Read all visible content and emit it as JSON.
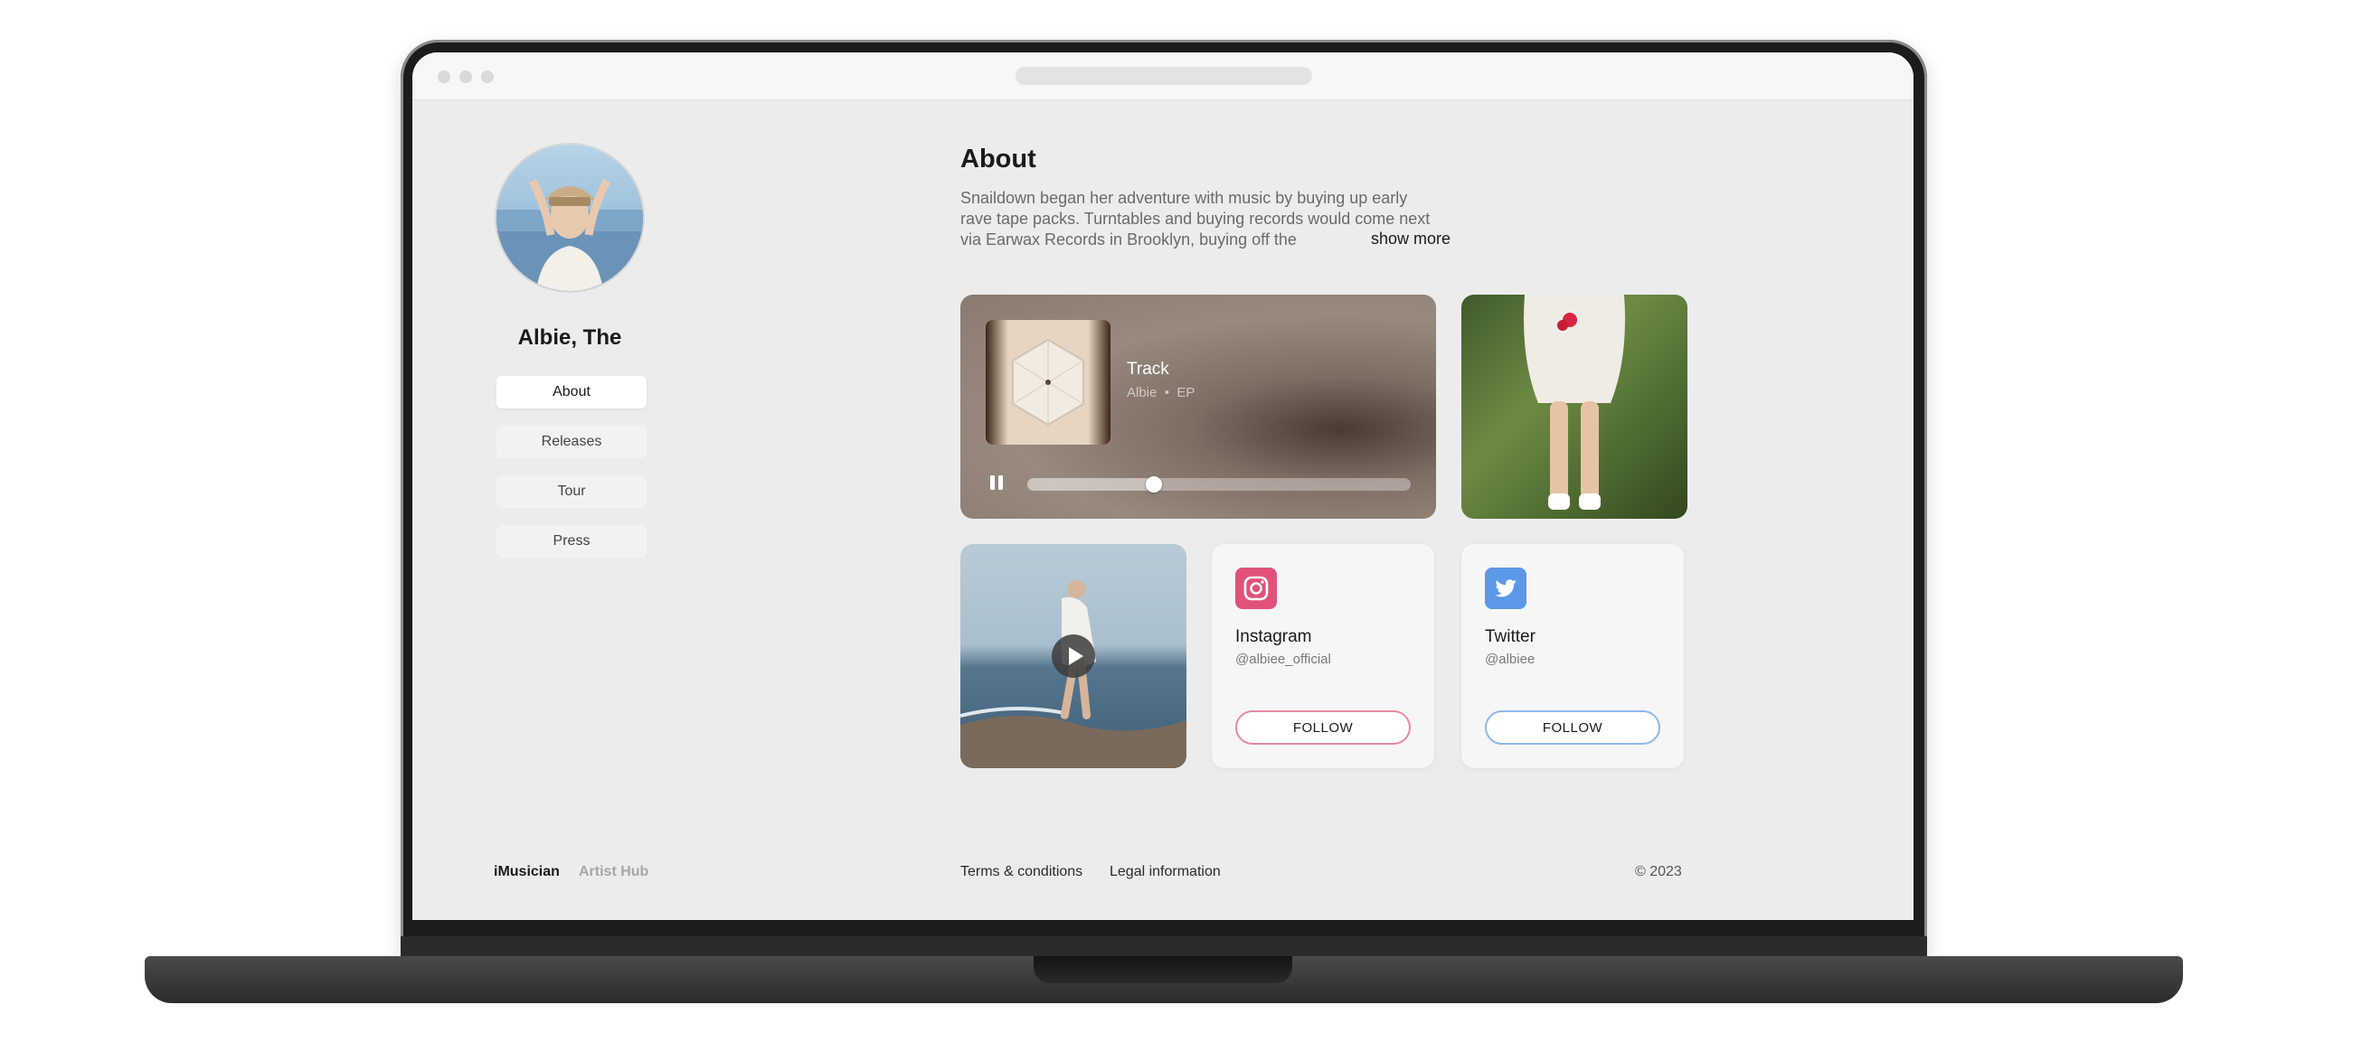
{
  "sidebar": {
    "artist_name": "Albie, The",
    "nav": [
      {
        "label": "About",
        "active": true
      },
      {
        "label": "Releases",
        "active": false
      },
      {
        "label": "Tour",
        "active": false
      },
      {
        "label": "Press",
        "active": false
      }
    ]
  },
  "about": {
    "title": "About",
    "text": "Snaildown began her adventure with music by buying up early rave tape packs. Turntables and buying records would come next via Earwax Records in Brooklyn, buying off the",
    "show_more": "show more"
  },
  "player": {
    "track_title": "Track",
    "artist": "Albie",
    "separator": "•",
    "release_type": "EP",
    "progress": 0.33,
    "pause_icon": "pause-icon"
  },
  "video": {
    "play_icon": "play-icon"
  },
  "socials": [
    {
      "name": "Instagram",
      "handle": "@albiee_official",
      "follow_label": "FOLLOW",
      "icon": "instagram-icon",
      "color": "#e1527a",
      "border": "#e58aa1"
    },
    {
      "name": "Twitter",
      "handle": "@albiee",
      "follow_label": "FOLLOW",
      "icon": "twitter-icon",
      "color": "#5b98e8",
      "border": "#8db8ee"
    }
  ],
  "footer": {
    "brand": "iMusician",
    "brand_sub": "Artist Hub",
    "links": [
      "Terms & conditions",
      "Legal information"
    ],
    "copyright": "© 2023"
  }
}
